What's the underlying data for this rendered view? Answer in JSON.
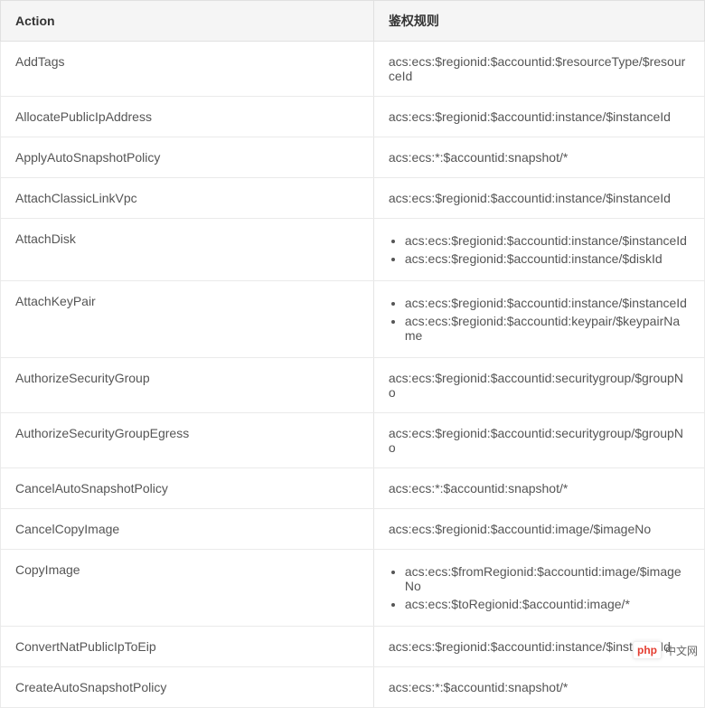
{
  "table": {
    "headers": {
      "action": "Action",
      "rule": "鉴权规则"
    },
    "rows": [
      {
        "action": "AddTags",
        "rules": [
          "acs:ecs:$regionid:$accountid:$resourceType/$resourceId"
        ]
      },
      {
        "action": "AllocatePublicIpAddress",
        "rules": [
          "acs:ecs:$regionid:$accountid:instance/$instanceId"
        ]
      },
      {
        "action": "ApplyAutoSnapshotPolicy",
        "rules": [
          "acs:ecs:*:$accountid:snapshot/*"
        ]
      },
      {
        "action": "AttachClassicLinkVpc",
        "rules": [
          "acs:ecs:$regionid:$accountid:instance/$instanceId"
        ]
      },
      {
        "action": "AttachDisk",
        "rules": [
          "acs:ecs:$regionid:$accountid:instance/$instanceId",
          "acs:ecs:$regionid:$accountid:instance/$diskId"
        ]
      },
      {
        "action": "AttachKeyPair",
        "rules": [
          "acs:ecs:$regionid:$accountid:instance/$instanceId",
          "acs:ecs:$regionid:$accountid:keypair/$keypairName"
        ]
      },
      {
        "action": "AuthorizeSecurityGroup",
        "rules": [
          "acs:ecs:$regionid:$accountid:securitygroup/$groupNo"
        ]
      },
      {
        "action": "AuthorizeSecurityGroupEgress",
        "rules": [
          "acs:ecs:$regionid:$accountid:securitygroup/$groupNo"
        ]
      },
      {
        "action": "CancelAutoSnapshotPolicy",
        "rules": [
          "acs:ecs:*:$accountid:snapshot/*"
        ]
      },
      {
        "action": "CancelCopyImage",
        "rules": [
          "acs:ecs:$regionid:$accountid:image/$imageNo"
        ]
      },
      {
        "action": "CopyImage",
        "rules": [
          "acs:ecs:$fromRegionid:$accountid:image/$imageNo",
          "acs:ecs:$toRegionid:$accountid:image/*"
        ]
      },
      {
        "action": "ConvertNatPublicIpToEip",
        "rules": [
          "acs:ecs:$regionid:$accountid:instance/$instanceId"
        ]
      },
      {
        "action": "CreateAutoSnapshotPolicy",
        "rules": [
          "acs:ecs:*:$accountid:snapshot/*"
        ]
      }
    ]
  },
  "watermark": {
    "logo": "php",
    "text": "中文网"
  }
}
